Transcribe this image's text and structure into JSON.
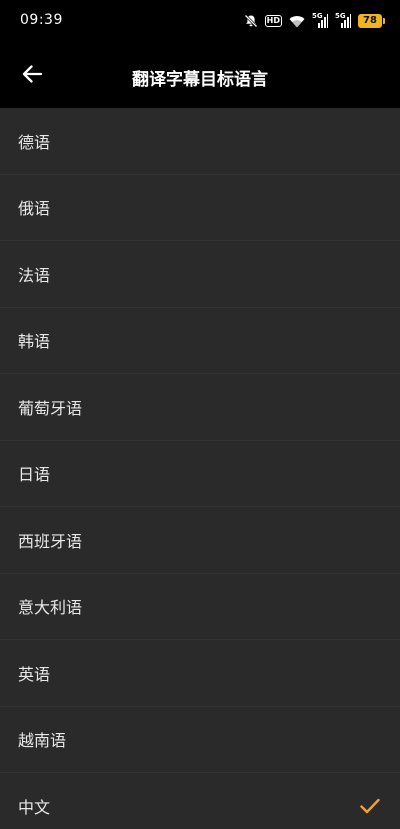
{
  "status_bar": {
    "time": "09:39",
    "hd_label": "HD",
    "signal1_label": "5G",
    "signal2_label": "5G",
    "battery_level": "78"
  },
  "header": {
    "title": "翻译字幕目标语言"
  },
  "languages": [
    {
      "label": "德语",
      "selected": false
    },
    {
      "label": "俄语",
      "selected": false
    },
    {
      "label": "法语",
      "selected": false
    },
    {
      "label": "韩语",
      "selected": false
    },
    {
      "label": "葡萄牙语",
      "selected": false
    },
    {
      "label": "日语",
      "selected": false
    },
    {
      "label": "西班牙语",
      "selected": false
    },
    {
      "label": "意大利语",
      "selected": false
    },
    {
      "label": "英语",
      "selected": false
    },
    {
      "label": "越南语",
      "selected": false
    },
    {
      "label": "中文",
      "selected": true
    }
  ],
  "colors": {
    "background": "#2a2a2a",
    "header": "#000000",
    "accent": "#f0a030",
    "battery": "#f0b41e"
  }
}
